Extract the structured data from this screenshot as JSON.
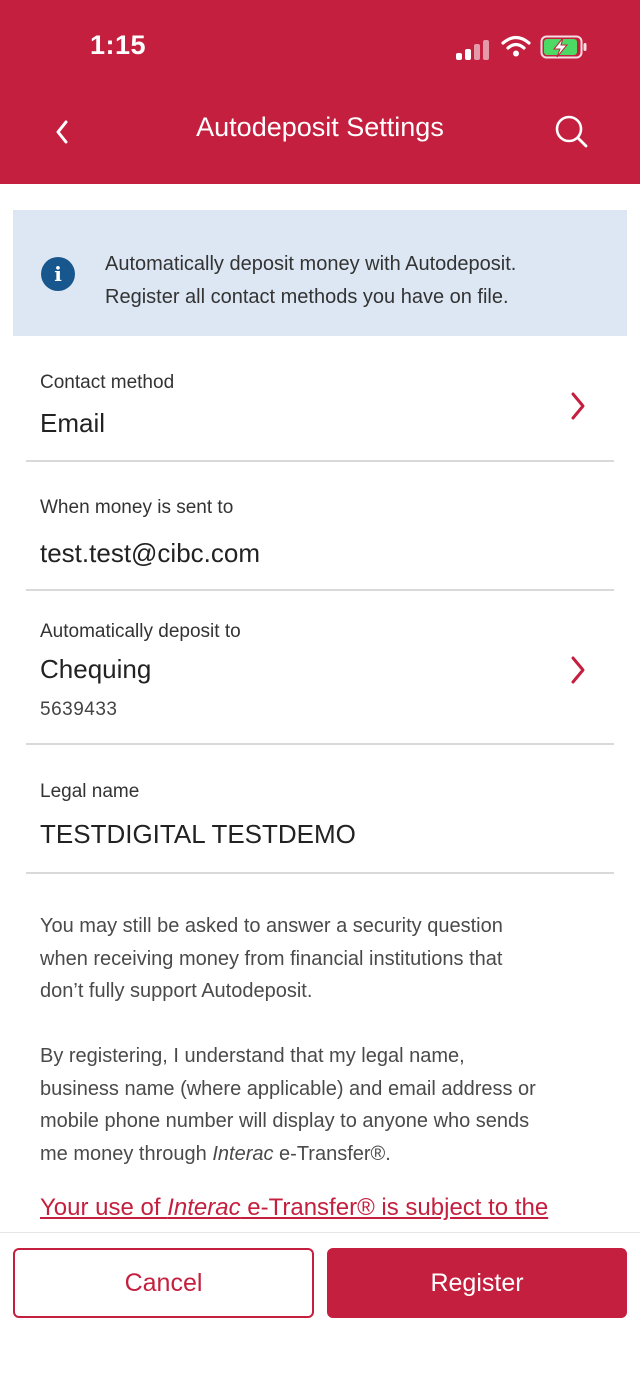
{
  "status_bar": {
    "time": "1:15"
  },
  "header": {
    "title": "Autodeposit Settings"
  },
  "icons": {
    "back": "chevron-left-icon",
    "search": "search-icon",
    "info": "info-icon",
    "chevron": "chevron-right-icon"
  },
  "colors": {
    "brand": "#c41f3e",
    "info_bg": "#dce7f3",
    "info_icon": "#18578d"
  },
  "info_banner": {
    "line1": "Automatically deposit money with Autodeposit.",
    "line2": "Register all contact methods you have on file."
  },
  "fields": {
    "contact_method": {
      "label": "Contact method",
      "value": "Email"
    },
    "sent_to": {
      "label": "When money is sent to",
      "value": "test.test@cibc.com"
    },
    "deposit_to": {
      "label": "Automatically deposit to",
      "value": "Chequing",
      "account": "5639433"
    },
    "legal_name": {
      "label": "Legal name",
      "value": "TESTDIGITAL TESTDEMO"
    }
  },
  "disclaimer": {
    "p1_l1": "You may still be asked to answer a security question",
    "p1_l2": "when receiving money from financial institutions that",
    "p1_l3": "don’t fully support Autodeposit.",
    "p2_l1": "By registering, I understand that my legal name,",
    "p2_l2": "business name (where applicable) and email address or",
    "p2_l3": "mobile phone number will display to anyone who sends",
    "p2_l4_a": "me money through ",
    "p2_l4_b": "Interac",
    "p2_l4_c": " e-Transfer®."
  },
  "terms_link": {
    "part1": "Your use of ",
    "part2": "Interac",
    "part3": " e-Transfer® is subject to the"
  },
  "buttons": {
    "cancel": "Cancel",
    "register": "Register"
  }
}
